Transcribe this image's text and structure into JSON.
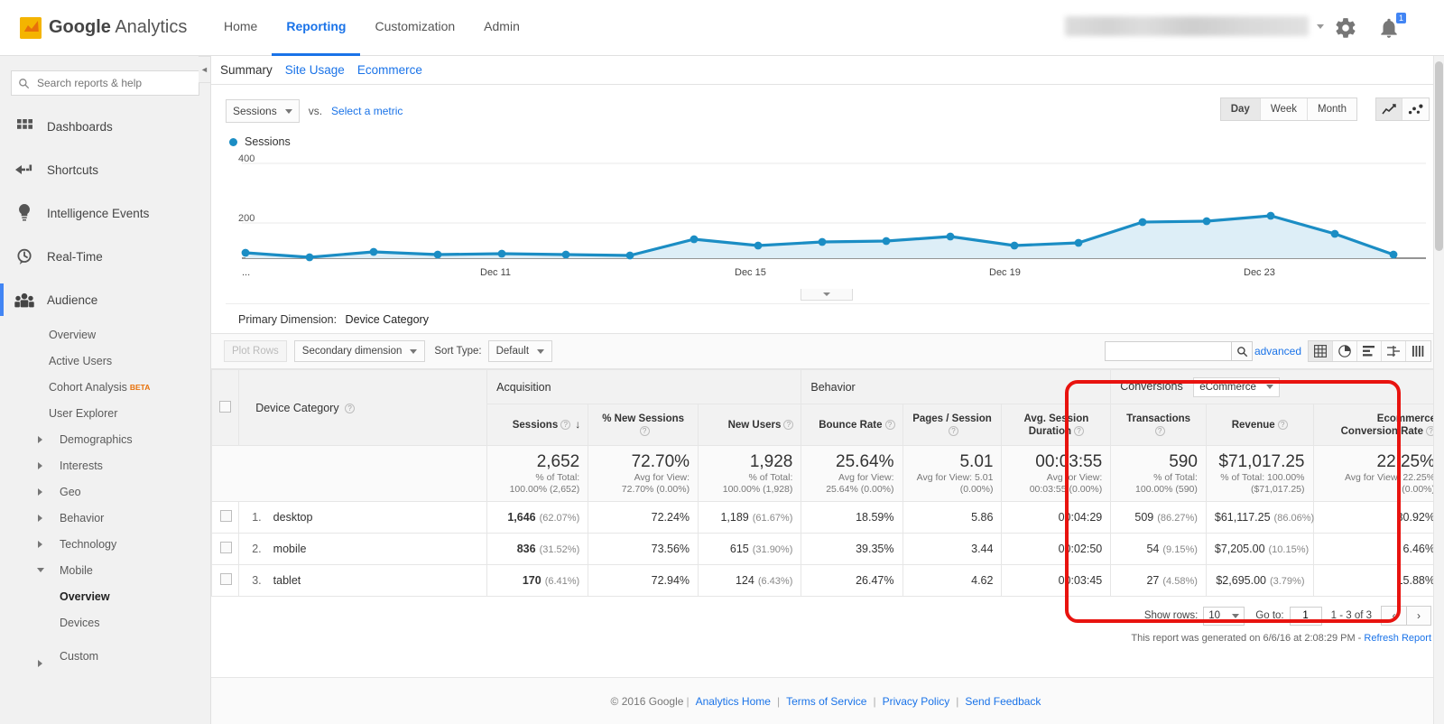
{
  "brand": {
    "google": "Google",
    "analytics": "Analytics"
  },
  "topnav": [
    {
      "label": "Home",
      "active": false
    },
    {
      "label": "Reporting",
      "active": true
    },
    {
      "label": "Customization",
      "active": false
    },
    {
      "label": "Admin",
      "active": false
    }
  ],
  "topbar_icons": {
    "gear": "gear-icon",
    "bell": "bell-icon",
    "bell_badge": "1"
  },
  "sidebar": {
    "search_placeholder": "Search reports & help",
    "items": [
      {
        "label": "Dashboards",
        "icon": "grid-icon"
      },
      {
        "label": "Shortcuts",
        "icon": "arrow-dashed-icon"
      },
      {
        "label": "Intelligence Events",
        "icon": "lightbulb-icon"
      },
      {
        "label": "Real-Time",
        "icon": "clock-icon"
      },
      {
        "label": "Audience",
        "icon": "people-icon"
      }
    ],
    "audience_children": [
      {
        "label": "Overview",
        "expandable": false,
        "bold": false
      },
      {
        "label": "Active Users",
        "expandable": false,
        "bold": false
      },
      {
        "label": "Cohort Analysis",
        "badge": "BETA",
        "expandable": false,
        "bold": false
      },
      {
        "label": "User Explorer",
        "expandable": false,
        "bold": false
      },
      {
        "label": "Demographics",
        "expandable": true,
        "open": false
      },
      {
        "label": "Interests",
        "expandable": true,
        "open": false
      },
      {
        "label": "Geo",
        "expandable": true,
        "open": false
      },
      {
        "label": "Behavior",
        "expandable": true,
        "open": false
      },
      {
        "label": "Technology",
        "expandable": true,
        "open": false
      },
      {
        "label": "Mobile",
        "expandable": true,
        "open": true
      }
    ],
    "mobile_children": [
      {
        "label": "Overview",
        "bold": true
      },
      {
        "label": "Devices",
        "bold": false
      }
    ],
    "custom": {
      "label": "Custom",
      "expandable": true,
      "open": false
    }
  },
  "report_tabs": [
    {
      "label": "Summary",
      "active": true
    },
    {
      "label": "Site Usage",
      "active": false
    },
    {
      "label": "Ecommerce",
      "active": false
    }
  ],
  "chart_controls": {
    "metric_select": "Sessions",
    "vs_label": "vs.",
    "select_metric_link": "Select a metric",
    "granularity": [
      {
        "label": "Day",
        "active": true
      },
      {
        "label": "Week",
        "active": false
      },
      {
        "label": "Month",
        "active": false
      }
    ],
    "chart_types": [
      {
        "name": "line-chart-icon",
        "active": true
      },
      {
        "name": "scatter-chart-icon",
        "active": false
      }
    ],
    "legend_label": "Sessions"
  },
  "chart_data": {
    "type": "line",
    "title": "Sessions",
    "xlabel": "",
    "ylabel": "Sessions",
    "ylim": [
      0,
      450
    ],
    "yticks": [
      200,
      400
    ],
    "grid": true,
    "legend": [
      "Sessions"
    ],
    "legend_position": "top-left",
    "color": "#1b8dc4",
    "x_tick_labels": [
      "...",
      "Dec 11",
      "Dec 15",
      "Dec 19",
      "Dec 23"
    ],
    "x": [
      "Dec 8",
      "Dec 9",
      "Dec 10",
      "Dec 11",
      "Dec 12",
      "Dec 13",
      "Dec 14",
      "Dec 15",
      "Dec 16",
      "Dec 17",
      "Dec 18",
      "Dec 19",
      "Dec 20",
      "Dec 21",
      "Dec 22",
      "Dec 23",
      "Dec 24",
      "Dec 25",
      "Dec 26"
    ],
    "values": [
      103,
      88,
      112,
      100,
      104,
      100,
      95,
      150,
      131,
      143,
      146,
      160,
      127,
      136,
      215,
      219,
      238,
      196,
      96
    ]
  },
  "primary_dimension": {
    "label": "Primary Dimension:",
    "value": "Device Category"
  },
  "table_toolbar": {
    "plot_rows": "Plot Rows",
    "secondary_dimension": "Secondary dimension",
    "sort_type_label": "Sort Type:",
    "sort_type_value": "Default",
    "search_value": "",
    "advanced": "advanced",
    "view_icons": [
      {
        "name": "table-view-icon",
        "active": true
      },
      {
        "name": "pie-view-icon",
        "active": false
      },
      {
        "name": "bar-view-icon",
        "active": false
      },
      {
        "name": "comparison-view-icon",
        "active": false
      },
      {
        "name": "pivot-view-icon",
        "active": false
      }
    ]
  },
  "table": {
    "groups": [
      {
        "label": "Acquisition"
      },
      {
        "label": "Behavior"
      },
      {
        "label": "Conversions",
        "select": "eCommerce"
      }
    ],
    "dimension_header": "Device Category",
    "columns": [
      "Sessions",
      "% New Sessions",
      "New Users",
      "Bounce Rate",
      "Pages / Session",
      "Avg. Session Duration",
      "Transactions",
      "Revenue",
      "Ecommerce Conversion Rate"
    ],
    "sorted_column": "Sessions",
    "sort_direction": "desc",
    "summary": [
      {
        "big": "2,652",
        "sub1": "% of Total:",
        "sub2": "100.00% (2,652)"
      },
      {
        "big": "72.70%",
        "sub1": "Avg for View:",
        "sub2": "72.70% (0.00%)"
      },
      {
        "big": "1,928",
        "sub1": "% of Total:",
        "sub2": "100.00% (1,928)"
      },
      {
        "big": "25.64%",
        "sub1": "Avg for View:",
        "sub2": "25.64% (0.00%)"
      },
      {
        "big": "5.01",
        "sub1": "Avg for View: 5.01",
        "sub2": "(0.00%)"
      },
      {
        "big": "00:03:55",
        "sub1": "Avg for View:",
        "sub2": "00:03:55 (0.00%)"
      },
      {
        "big": "590",
        "sub1": "% of Total:",
        "sub2": "100.00% (590)"
      },
      {
        "big": "$71,017.25",
        "sub1": "% of Total: 100.00%",
        "sub2": "($71,017.25)"
      },
      {
        "big": "22.25%",
        "sub1": "Avg for View: 22.25%",
        "sub2": "(0.00%)"
      }
    ],
    "rows": [
      {
        "index": "1.",
        "name": "desktop",
        "sessions": "1,646",
        "sessions_pct": "(62.07%)",
        "new_sessions": "72.24%",
        "new_users": "1,189",
        "new_users_pct": "(61.67%)",
        "bounce_rate": "18.59%",
        "pages_session": "5.86",
        "avg_duration": "00:04:29",
        "transactions": "509",
        "transactions_pct": "(86.27%)",
        "revenue": "$61,117.25",
        "revenue_pct": "(86.06%)",
        "ecommerce_rate": "30.92%"
      },
      {
        "index": "2.",
        "name": "mobile",
        "sessions": "836",
        "sessions_pct": "(31.52%)",
        "new_sessions": "73.56%",
        "new_users": "615",
        "new_users_pct": "(31.90%)",
        "bounce_rate": "39.35%",
        "pages_session": "3.44",
        "avg_duration": "00:02:50",
        "transactions": "54",
        "transactions_pct": "(9.15%)",
        "revenue": "$7,205.00",
        "revenue_pct": "(10.15%)",
        "ecommerce_rate": "6.46%"
      },
      {
        "index": "3.",
        "name": "tablet",
        "sessions": "170",
        "sessions_pct": "(6.41%)",
        "new_sessions": "72.94%",
        "new_users": "124",
        "new_users_pct": "(6.43%)",
        "bounce_rate": "26.47%",
        "pages_session": "4.62",
        "avg_duration": "00:03:45",
        "transactions": "27",
        "transactions_pct": "(4.58%)",
        "revenue": "$2,695.00",
        "revenue_pct": "(3.79%)",
        "ecommerce_rate": "15.88%"
      }
    ]
  },
  "pagination": {
    "show_rows_label": "Show rows:",
    "rows_value": "10",
    "goto_label": "Go to:",
    "goto_value": "1",
    "range": "1 - 3 of 3",
    "prev": "‹",
    "next": "›"
  },
  "generated": {
    "text": "This report was generated on 6/6/16 at 2:08:29 PM - ",
    "refresh": "Refresh Report"
  },
  "footer": {
    "copyright": "© 2016 Google",
    "links": [
      "Analytics Home",
      "Terms of Service",
      "Privacy Policy",
      "Send Feedback"
    ]
  },
  "annotation": {
    "color": "#e8130f",
    "shape": "rounded-rect-highlight"
  }
}
